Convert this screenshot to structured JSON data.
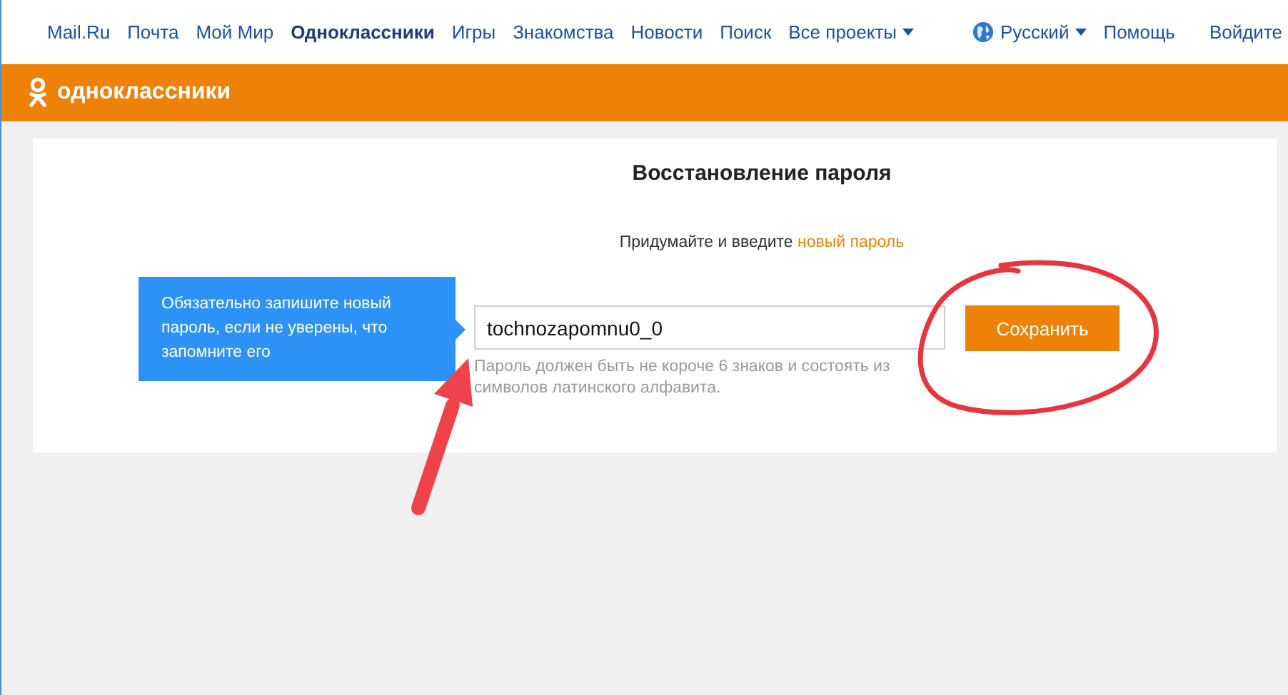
{
  "top_nav": {
    "items": [
      {
        "label": "Mail.Ru",
        "selected": false,
        "dropdown": false
      },
      {
        "label": "Почта",
        "selected": false,
        "dropdown": false
      },
      {
        "label": "Мой Мир",
        "selected": false,
        "dropdown": false
      },
      {
        "label": "Одноклассники",
        "selected": true,
        "dropdown": false
      },
      {
        "label": "Игры",
        "selected": false,
        "dropdown": false
      },
      {
        "label": "Знакомства",
        "selected": false,
        "dropdown": false
      },
      {
        "label": "Новости",
        "selected": false,
        "dropdown": false
      },
      {
        "label": "Поиск",
        "selected": false,
        "dropdown": false
      },
      {
        "label": "Все проекты",
        "selected": false,
        "dropdown": true
      }
    ],
    "language": "Русский",
    "help": "Помощь",
    "login": "Войдите"
  },
  "brand_bar": {
    "logo_text": "одноклассники"
  },
  "form": {
    "title": "Восстановление пароля",
    "subtitle_prefix": "Придумайте и введите ",
    "subtitle_link": "новый пароль",
    "tooltip": "Обязательно запишите новый пароль, если не уверены, что запомните его",
    "password": {
      "value": "tochnozapomnu0_0"
    },
    "hint": "Пароль должен быть не короче 6 знаков и состоять из символов латинского алфавита.",
    "save_button": "Сохранить"
  }
}
